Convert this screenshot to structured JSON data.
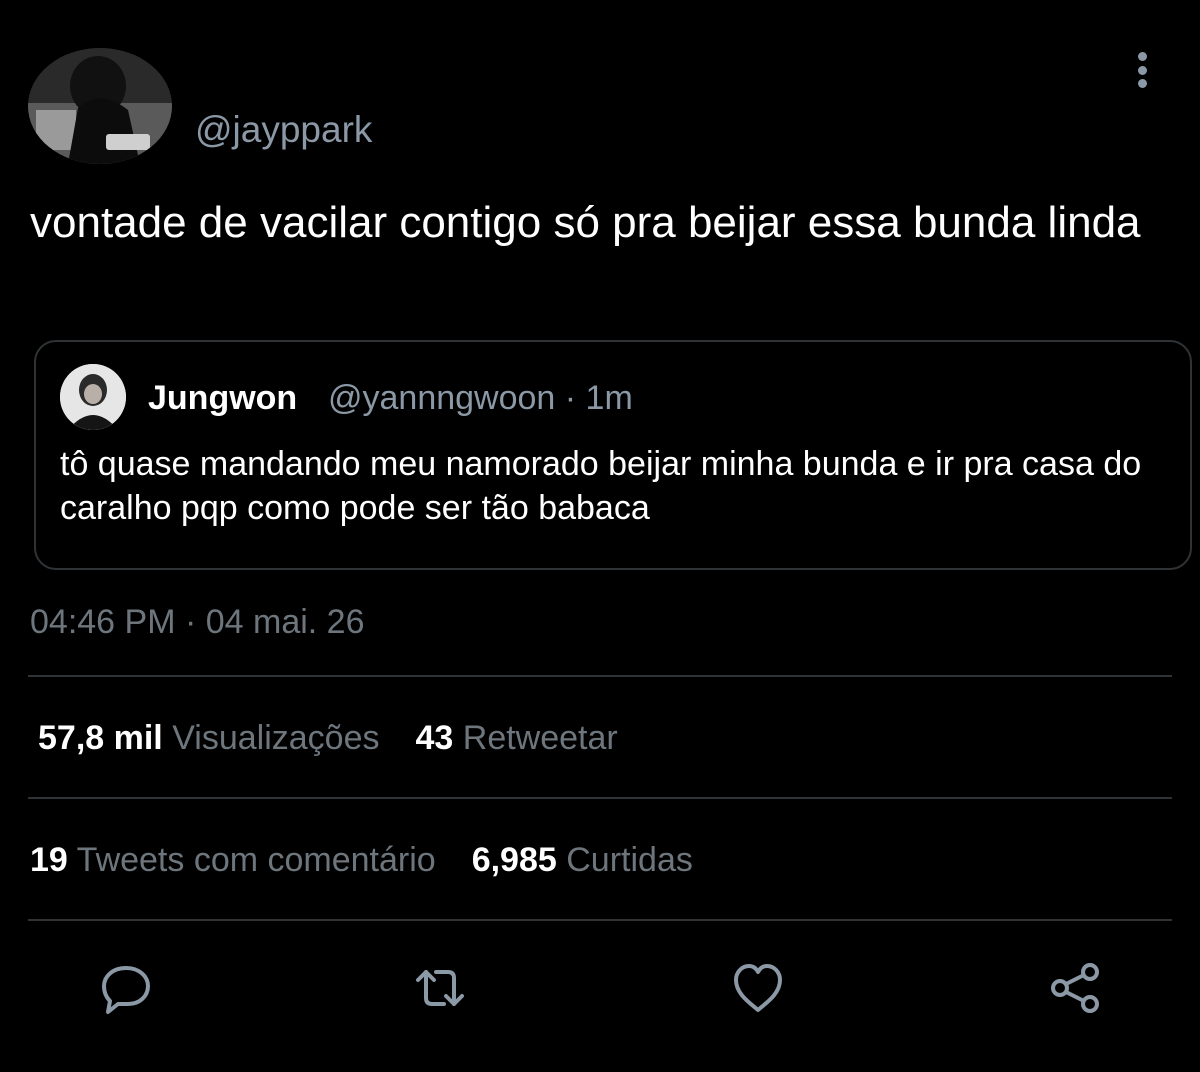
{
  "tweet": {
    "handle": "@jayppark",
    "text": "vontade de vacilar contigo só pra beijar essa bunda linda",
    "timestamp": "04:46 PM · 04 mai. 26"
  },
  "quoted_tweet": {
    "display_name": "Jungwon",
    "meta": "@yannngwoon · 1m",
    "text": "tô quase mandando meu namorado beijar minha bunda e ir pra casa do caralho pqp como pode ser tão babaca"
  },
  "stats": {
    "views_count": "57,8 mil",
    "views_label": "Visualizações",
    "retweets_count": "43",
    "retweets_label": "Retweetar",
    "quotes_count": "19",
    "quotes_label": "Tweets com comentário",
    "likes_count": "6,985",
    "likes_label": "Curtidas"
  },
  "actions": {
    "reply_icon": "reply-icon",
    "retweet_icon": "retweet-icon",
    "like_icon": "heart-icon",
    "share_icon": "share-icon"
  },
  "colors": {
    "background": "#000000",
    "primary_text": "#ffffff",
    "secondary_text": "#8b98a5",
    "divider": "#2f3336"
  }
}
